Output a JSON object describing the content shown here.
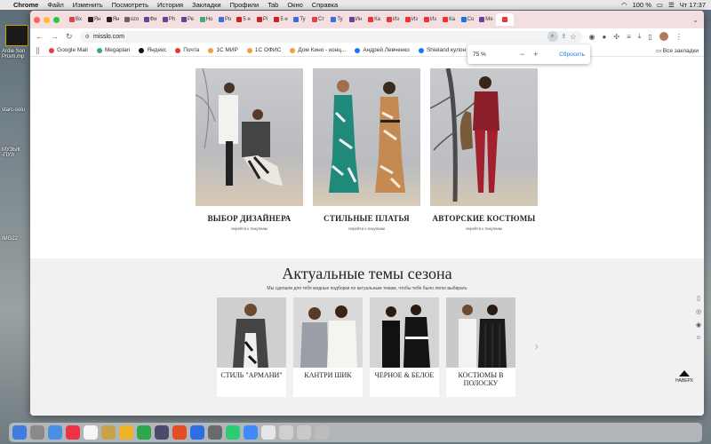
{
  "menubar": {
    "app": "Chrome",
    "items": [
      "Файл",
      "Изменить",
      "Посмотреть",
      "История",
      "Закладки",
      "Профили",
      "Tab",
      "Окно",
      "Справка"
    ],
    "battery": "100 %",
    "clock": "Чт 17:37"
  },
  "desktop": {
    "items": [
      "Ardie Son Prism.mp",
      "starc-solu",
      "МУЗЫК -ПУ.h",
      "IMG22"
    ]
  },
  "browser": {
    "tabs": [
      {
        "label": "Вх",
        "color": "#d44"
      },
      {
        "label": "Ян",
        "color": "#222"
      },
      {
        "label": "Ян",
        "color": "#222"
      },
      {
        "label": "ozo",
        "color": "#666"
      },
      {
        "label": "Фи",
        "color": "#6b3fa0"
      },
      {
        "label": "Ph",
        "color": "#6b3fa0"
      },
      {
        "label": "Ре",
        "color": "#6b3fa0"
      },
      {
        "label": "Но",
        "color": "#4a7"
      },
      {
        "label": "Ро",
        "color": "#3a6fd8"
      },
      {
        "label": "5 н",
        "color": "#c22"
      },
      {
        "label": "Pi",
        "color": "#c22"
      },
      {
        "label": "5 н",
        "color": "#c22"
      },
      {
        "label": "Ту",
        "color": "#3a6fd8"
      },
      {
        "label": "Ст",
        "color": "#d44"
      },
      {
        "label": "Ту",
        "color": "#3a6fd8"
      },
      {
        "label": "Ин",
        "color": "#6b3fa0"
      },
      {
        "label": "Ка",
        "color": "#e33"
      },
      {
        "label": "Из",
        "color": "#e33"
      },
      {
        "label": "Из",
        "color": "#e33"
      },
      {
        "label": "Из",
        "color": "#e33"
      },
      {
        "label": "Ка",
        "color": "#e33"
      },
      {
        "label": "Co",
        "color": "#1a73e8"
      },
      {
        "label": "Ме",
        "color": "#6b3fa0"
      },
      {
        "label": "",
        "color": "#e33"
      }
    ],
    "url": "misslo.com",
    "bookmarks": [
      {
        "label": "Google Mail",
        "color": "#d44"
      },
      {
        "label": "Megaplan",
        "color": "#3a8"
      },
      {
        "label": "Яндекс",
        "color": "#111"
      },
      {
        "label": "Почта",
        "color": "#e33"
      },
      {
        "label": "1С МИР",
        "color": "#e8a33d"
      },
      {
        "label": "1С ОФИС",
        "color": "#e8a33d"
      },
      {
        "label": "Дом Кино - конц...",
        "color": "#e8a33d"
      },
      {
        "label": "Андрей Левченко",
        "color": "#1877f2"
      },
      {
        "label": "Shieland кулон и...",
        "color": "#1877f2"
      }
    ],
    "all_bookmarks": "Все закладки",
    "zoom": {
      "value": "75 %",
      "minus": "−",
      "plus": "+",
      "reset": "Сбросить"
    }
  },
  "page": {
    "categories": [
      {
        "title": "ВЫБОР ДИЗАЙНЕРА",
        "link": "перейти к покупкам"
      },
      {
        "title": "СТИЛЬНЫЕ ПЛАТЬЯ",
        "link": "перейти к покупкам"
      },
      {
        "title": "АВТОРСКИЕ КОСТЮМЫ",
        "link": "перейти к покупкам"
      }
    ],
    "season": {
      "title": "Актуальные темы сезона",
      "lead": "Мы сделали для тебя модные подборки по актуальным темам, чтобы тебе было легко выбирать",
      "cards": [
        "СТИЛЬ \"АРМАНИ\"",
        "КАНТРИ ШИК",
        "ЧЕРНОЕ & БЕЛОЕ",
        "КОСТЮМЫ В ПОЛОСКУ"
      ]
    },
    "to_top": "НАВЕРХ"
  },
  "colors": {
    "accent": "#1a73e8",
    "tab_strip": "#f3dfe0"
  }
}
